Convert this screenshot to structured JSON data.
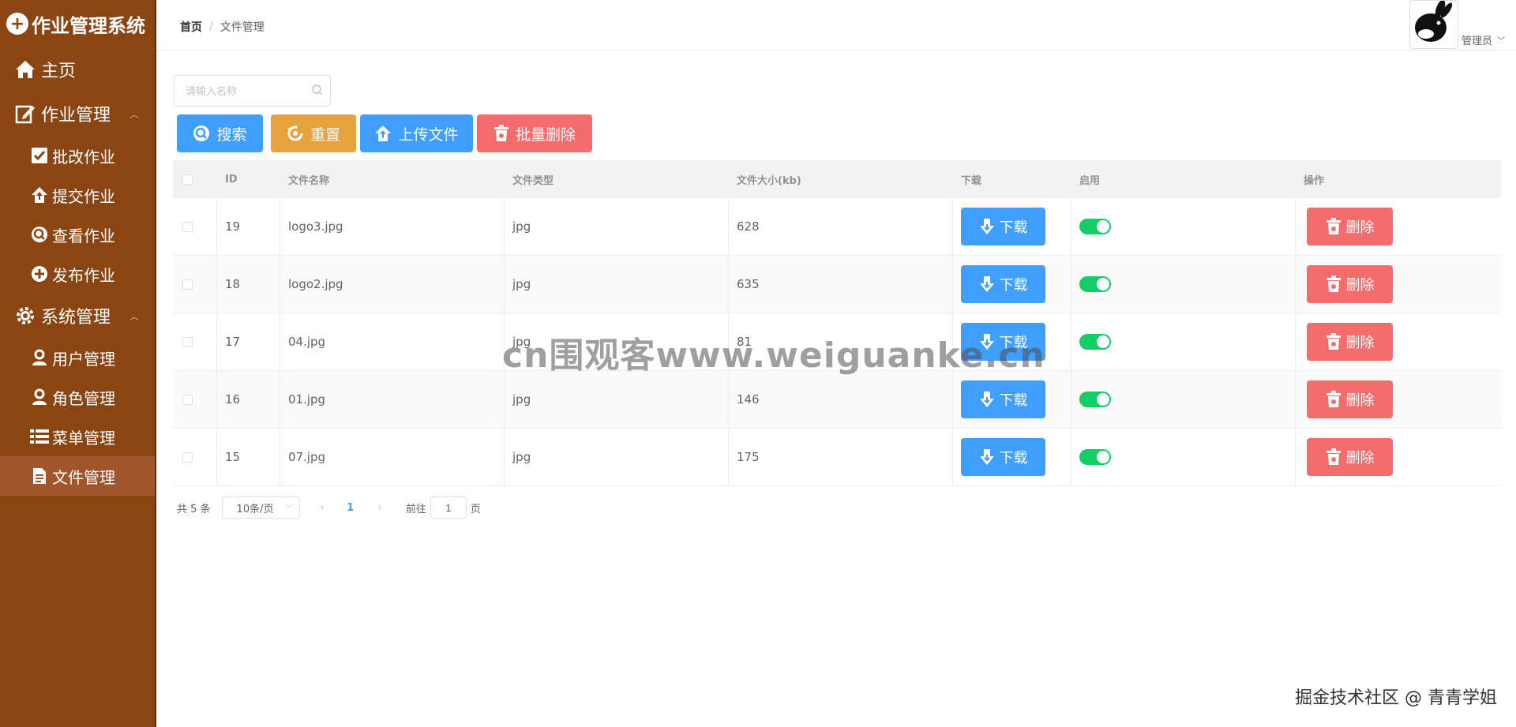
{
  "app": {
    "title": "作业管理系统"
  },
  "sidebar": {
    "items": [
      {
        "label": "主页",
        "icon": "home-icon"
      },
      {
        "label": "作业管理",
        "icon": "edit-icon",
        "children": [
          {
            "label": "批改作业",
            "icon": "check-square-icon"
          },
          {
            "label": "提交作业",
            "icon": "upload-house-icon"
          },
          {
            "label": "查看作业",
            "icon": "search-circle-icon"
          },
          {
            "label": "发布作业",
            "icon": "plus-circle-icon"
          }
        ]
      },
      {
        "label": "系统管理",
        "icon": "gear-icon",
        "children": [
          {
            "label": "用户管理",
            "icon": "user-icon"
          },
          {
            "label": "角色管理",
            "icon": "user-icon"
          },
          {
            "label": "菜单管理",
            "icon": "list-icon"
          },
          {
            "label": "文件管理",
            "icon": "file-icon",
            "active": true
          }
        ]
      }
    ]
  },
  "header": {
    "breadcrumb": {
      "home": "首页",
      "separator": "/",
      "current": "文件管理"
    },
    "user": {
      "name": "管理员"
    }
  },
  "toolbar": {
    "search_placeholder": "请输入名称",
    "search_label": "搜索",
    "reset_label": "重置",
    "upload_label": "上传文件",
    "bulk_delete_label": "批量删除"
  },
  "table": {
    "columns": [
      "ID",
      "文件名称",
      "文件类型",
      "文件大小(kb)",
      "下载",
      "启用",
      "操作"
    ],
    "download_label": "下载",
    "delete_label": "删除",
    "rows": [
      {
        "id": "19",
        "name": "logo3.jpg",
        "type": "jpg",
        "size": "628",
        "enabled": true
      },
      {
        "id": "18",
        "name": "logo2.jpg",
        "type": "jpg",
        "size": "635",
        "enabled": true
      },
      {
        "id": "17",
        "name": "04.jpg",
        "type": "jpg",
        "size": "81",
        "enabled": true
      },
      {
        "id": "16",
        "name": "01.jpg",
        "type": "jpg",
        "size": "146",
        "enabled": true
      },
      {
        "id": "15",
        "name": "07.jpg",
        "type": "jpg",
        "size": "175",
        "enabled": true
      }
    ]
  },
  "pagination": {
    "total_text": "共 5 条",
    "page_size": "10条/页",
    "current_page": "1",
    "goto_label": "前往",
    "goto_value": "1",
    "page_suffix": "页"
  },
  "watermarks": {
    "center": "cn围观客www.weiguanke.cn",
    "corner": "掘金技术社区 @ 青青学姐"
  },
  "colors": {
    "sidebar": "#8b4513",
    "primary": "#409eff",
    "warning": "#e6a23c",
    "danger": "#f56c6c",
    "success": "#13ce66"
  }
}
